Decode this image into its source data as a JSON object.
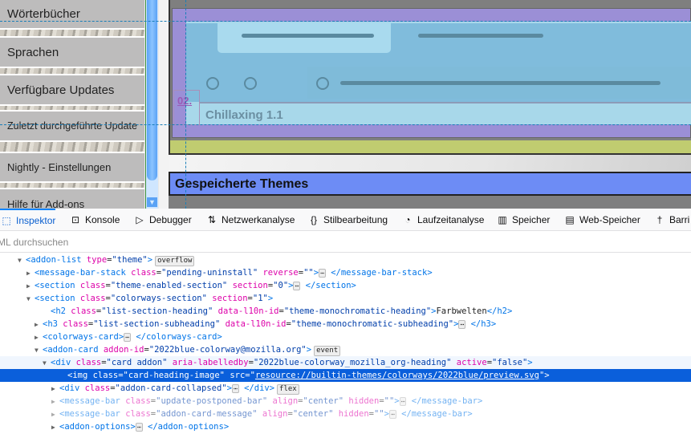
{
  "sidebar": {
    "items": [
      "Wörterbücher",
      "Sprachen",
      "Verfügbare Updates",
      "Zuletzt durchgeführte Update",
      "Nightly - Einstellungen",
      "Hilfe für Add-ons"
    ]
  },
  "preview": {
    "card_title": "Chillaxing 1.1",
    "overlay_label": "02.",
    "section_heading": "Gespeicherte Themes"
  },
  "devtools": {
    "tabs": [
      {
        "label": "Inspektor",
        "icon": "inspector-icon"
      },
      {
        "label": "Konsole",
        "icon": "console-icon"
      },
      {
        "label": "Debugger",
        "icon": "debugger-icon"
      },
      {
        "label": "Netzwerkanalyse",
        "icon": "network-icon"
      },
      {
        "label": "Stilbearbeitung",
        "icon": "style-editor-icon"
      },
      {
        "label": "Laufzeitanalyse",
        "icon": "performance-icon"
      },
      {
        "label": "Speicher",
        "icon": "memory-icon"
      },
      {
        "label": "Web-Speicher",
        "icon": "storage-icon"
      },
      {
        "label": "Barri",
        "icon": "accessibility-icon"
      }
    ],
    "search_placeholder": "ML durchsuchen",
    "tree": [
      {
        "open": "<addon-list ",
        "a1": "type",
        "v1": "\"theme\"",
        "close": ">",
        "badge": "overflow"
      },
      {
        "open": "<message-bar-stack ",
        "a1": "class",
        "v1": "\"pending-uninstall\"",
        "a2": "reverse",
        "v2": "\"\"",
        "close": ">",
        "end": "</message-bar-stack>"
      },
      {
        "open": "<section ",
        "a1": "class",
        "v1": "\"theme-enabled-section\"",
        "a2": "section",
        "v2": "\"0\"",
        "close": ">",
        "end": "</section>"
      },
      {
        "open": "<section ",
        "a1": "class",
        "v1": "\"colorways-section\"",
        "a2": "section",
        "v2": "\"1\"",
        "close": ">"
      },
      {
        "open": "<h2 ",
        "a1": "class",
        "v1": "\"list-section-heading\"",
        "a2": "data-l10n-id",
        "v2": "\"theme-monochromatic-heading\"",
        "close": ">",
        "text": "Farbwelten",
        "end": "</h2>"
      },
      {
        "open": "<h3 ",
        "a1": "class",
        "v1": "\"list-section-subheading\"",
        "a2": "data-l10n-id",
        "v2": "\"theme-monochromatic-subheading\"",
        "close": ">",
        "end": "</h3>"
      },
      {
        "open": "<colorways-card",
        "close": ">",
        "end": "</colorways-card>"
      },
      {
        "open": "<addon-card ",
        "a1": "addon-id",
        "v1": "\"2022blue-colorway@mozilla.org\"",
        "close": ">",
        "badge": "event"
      },
      {
        "open": "<div ",
        "a1": "class",
        "v1": "\"card addon\"",
        "a2": "aria-labelledby",
        "v2": "\"2022blue-colorway_mozilla_org-heading\"",
        "a3": "active",
        "v3": "\"false\"",
        "close": ">"
      },
      {
        "open": "<img ",
        "a1": "class",
        "v1": "\"card-heading-image\"",
        "a2": "src",
        "v2": "resource://builtin-themes/colorways/2022blue/preview.svg",
        "close": "\">"
      },
      {
        "open": "<div ",
        "a1": "class",
        "v1": "\"addon-card-collapsed\"",
        "close": ">",
        "end": "</div>",
        "badge": "flex"
      },
      {
        "open": "<message-bar ",
        "a1": "class",
        "v1": "\"update-postponed-bar\"",
        "a2": "align",
        "v2": "\"center\"",
        "a3": "hidden",
        "v3": "\"\"",
        "close": ">",
        "end": "</message-bar>"
      },
      {
        "open": "<message-bar ",
        "a1": "class",
        "v1": "\"addon-card-message\"",
        "a2": "align",
        "v2": "\"center\"",
        "a3": "hidden",
        "v3": "\"\"",
        "close": ">",
        "end": "</message-bar>"
      },
      {
        "open": "<addon-options",
        "close": ">",
        "end": "</addon-options>"
      }
    ]
  }
}
